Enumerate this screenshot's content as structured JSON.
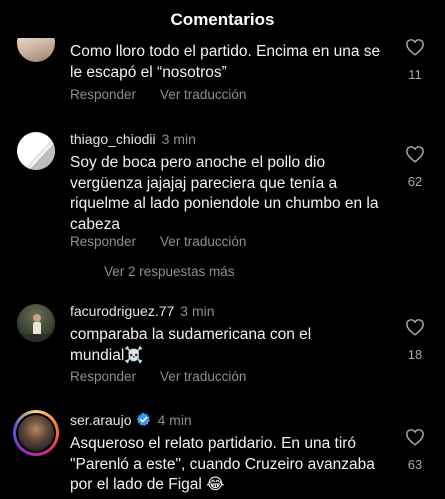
{
  "header": {
    "title": "Comentarios"
  },
  "actions": {
    "reply": "Responder",
    "translate": "Ver traducción"
  },
  "comments": [
    {
      "username": "",
      "time": "",
      "text": "Como lloro todo el partido. Encima en una se le escapó el “nosotros”",
      "likes": "11"
    },
    {
      "username": "thiago_chiodii",
      "time": "3 min",
      "text": "Soy de boca pero anoche el pollo dio vergüenza jajajaj pareciera que tenía a riquelme al lado poniendole un chumbo en la cabeza",
      "likes": "62",
      "replies_link": "Ver 2 respuestas más"
    },
    {
      "username": "facurodriguez.77",
      "time": "3 min",
      "text": "comparaba la sudamericana con el mundial☠️",
      "likes": "18"
    },
    {
      "username": "ser.araujo",
      "time": "4 min",
      "verified": true,
      "text": "Asqueroso el relato partidario. En una tiró \"Parenló a este\", cuando Cruzeiro avanzaba por el lado de Figal 😂",
      "likes": "63"
    }
  ]
}
